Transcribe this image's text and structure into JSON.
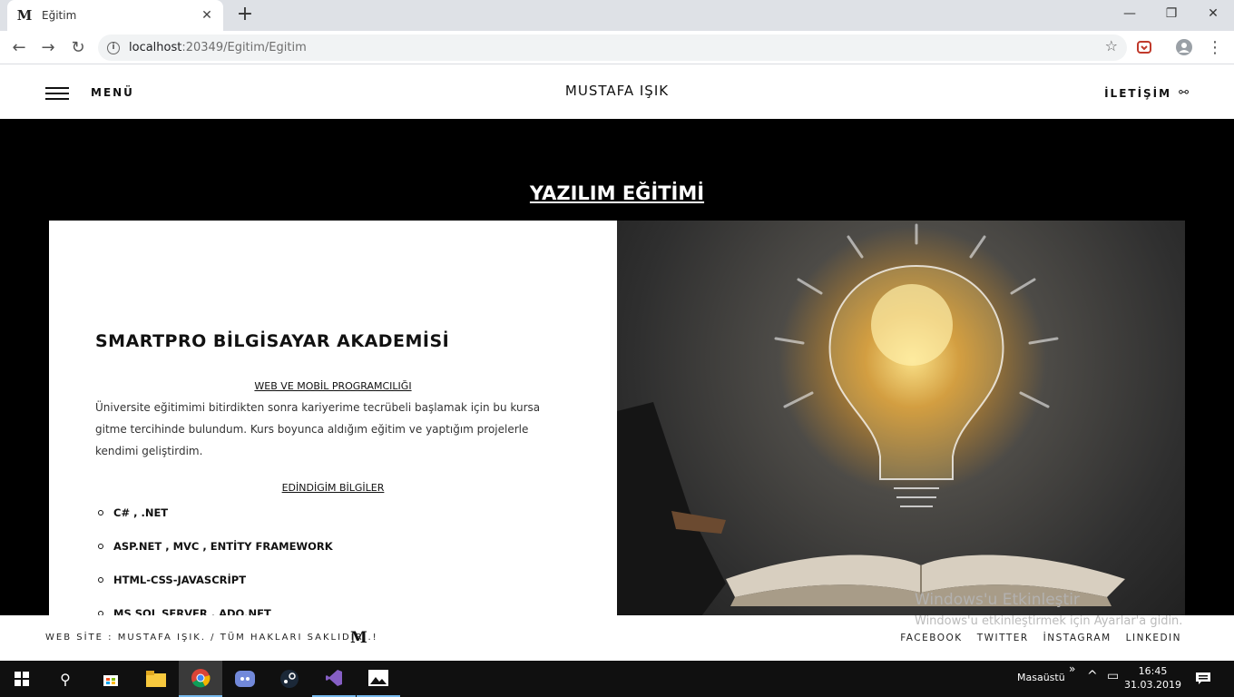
{
  "browser": {
    "tab_title": "Eğitim",
    "tab_favicon": "M",
    "url_host": "localhost",
    "url_path": ":20349/Egitim/Egitim"
  },
  "header": {
    "menu_label": "MENÜ",
    "brand": "MUSTAFA IŞIK",
    "contact_label": "İLETİŞİM"
  },
  "main": {
    "page_title": "YAZILIM EĞİTİMİ",
    "card": {
      "heading": "SMARTPRO BİLGİSAYAR AKADEMİSİ",
      "subheading_1": "WEB VE MOBİL PROGRAMCILIĞI",
      "paragraph": "Üniversite eğitimimi bitirdikten sonra kariyerime tecrübeli başlamak için bu kursa gitme tercihinde bulundum. Kurs boyunca aldığım eğitim ve yaptığım projelerle kendimi geliştirdim.",
      "subheading_2": "EDİNDİGİM BİLGİLER",
      "skills": [
        "C# , .NET",
        "ASP.NET , MVC , ENTİTY FRAMEWORK",
        "HTML-CSS-JAVASCRİPT",
        "MS SQL SERVER , ADO.NET"
      ]
    },
    "image_alt": "lightbulb-over-book"
  },
  "footer": {
    "copyright": "WEB SİTE : MUSTAFA IŞIK. / TÜM HAKLARI SAKLIDIR..!",
    "logo": "M",
    "social": [
      "FACEBOOK",
      "TWITTER",
      "İNSTAGRAM",
      "LINKEDIN"
    ]
  },
  "watermark": {
    "line1": "Windows'u Etkinleştir",
    "line2": "Windows'u etkinleştirmek için Ayarlar'a gidin."
  },
  "taskbar": {
    "desktop_label": "Masaüstü",
    "time": "16:45",
    "date": "31.03.2019"
  },
  "colors": {
    "page_bg": "#000000",
    "card_bg": "#ffffff",
    "taskbar_bg": "#101010"
  }
}
